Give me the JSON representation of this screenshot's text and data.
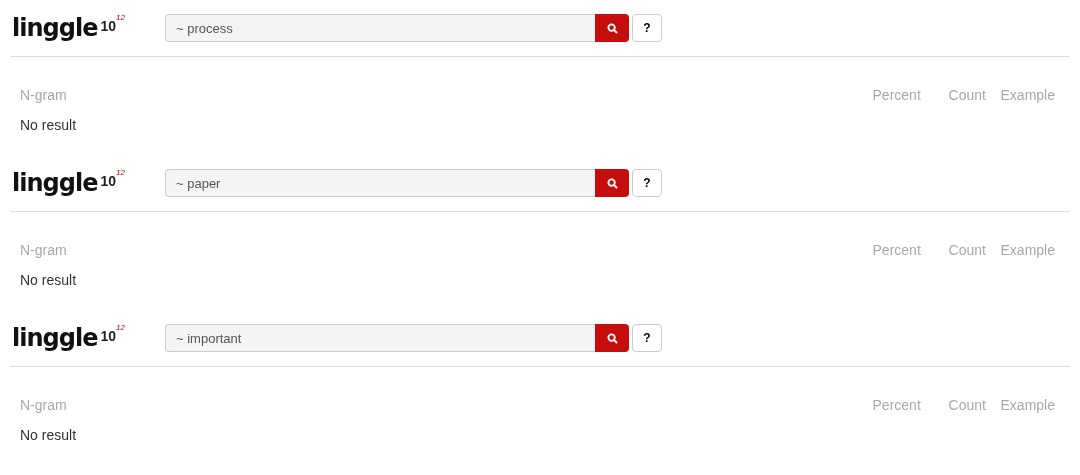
{
  "panels": [
    {
      "logo": {
        "name": "linggle",
        "base": "10",
        "exponent": "12"
      },
      "search": {
        "value": "~ process"
      },
      "help_button": "?",
      "columns": [
        "N-gram",
        "Percent",
        "Count",
        "Example"
      ],
      "message": "No result"
    },
    {
      "logo": {
        "name": "linggle",
        "base": "10",
        "exponent": "12"
      },
      "search": {
        "value": "~ paper"
      },
      "help_button": "?",
      "columns": [
        "N-gram",
        "Percent",
        "Count",
        "Example"
      ],
      "message": "No result"
    },
    {
      "logo": {
        "name": "linggle",
        "base": "10",
        "exponent": "12"
      },
      "search": {
        "value": "~ important"
      },
      "help_button": "?",
      "columns": [
        "N-gram",
        "Percent",
        "Count",
        "Example"
      ],
      "message": "No result"
    }
  ]
}
